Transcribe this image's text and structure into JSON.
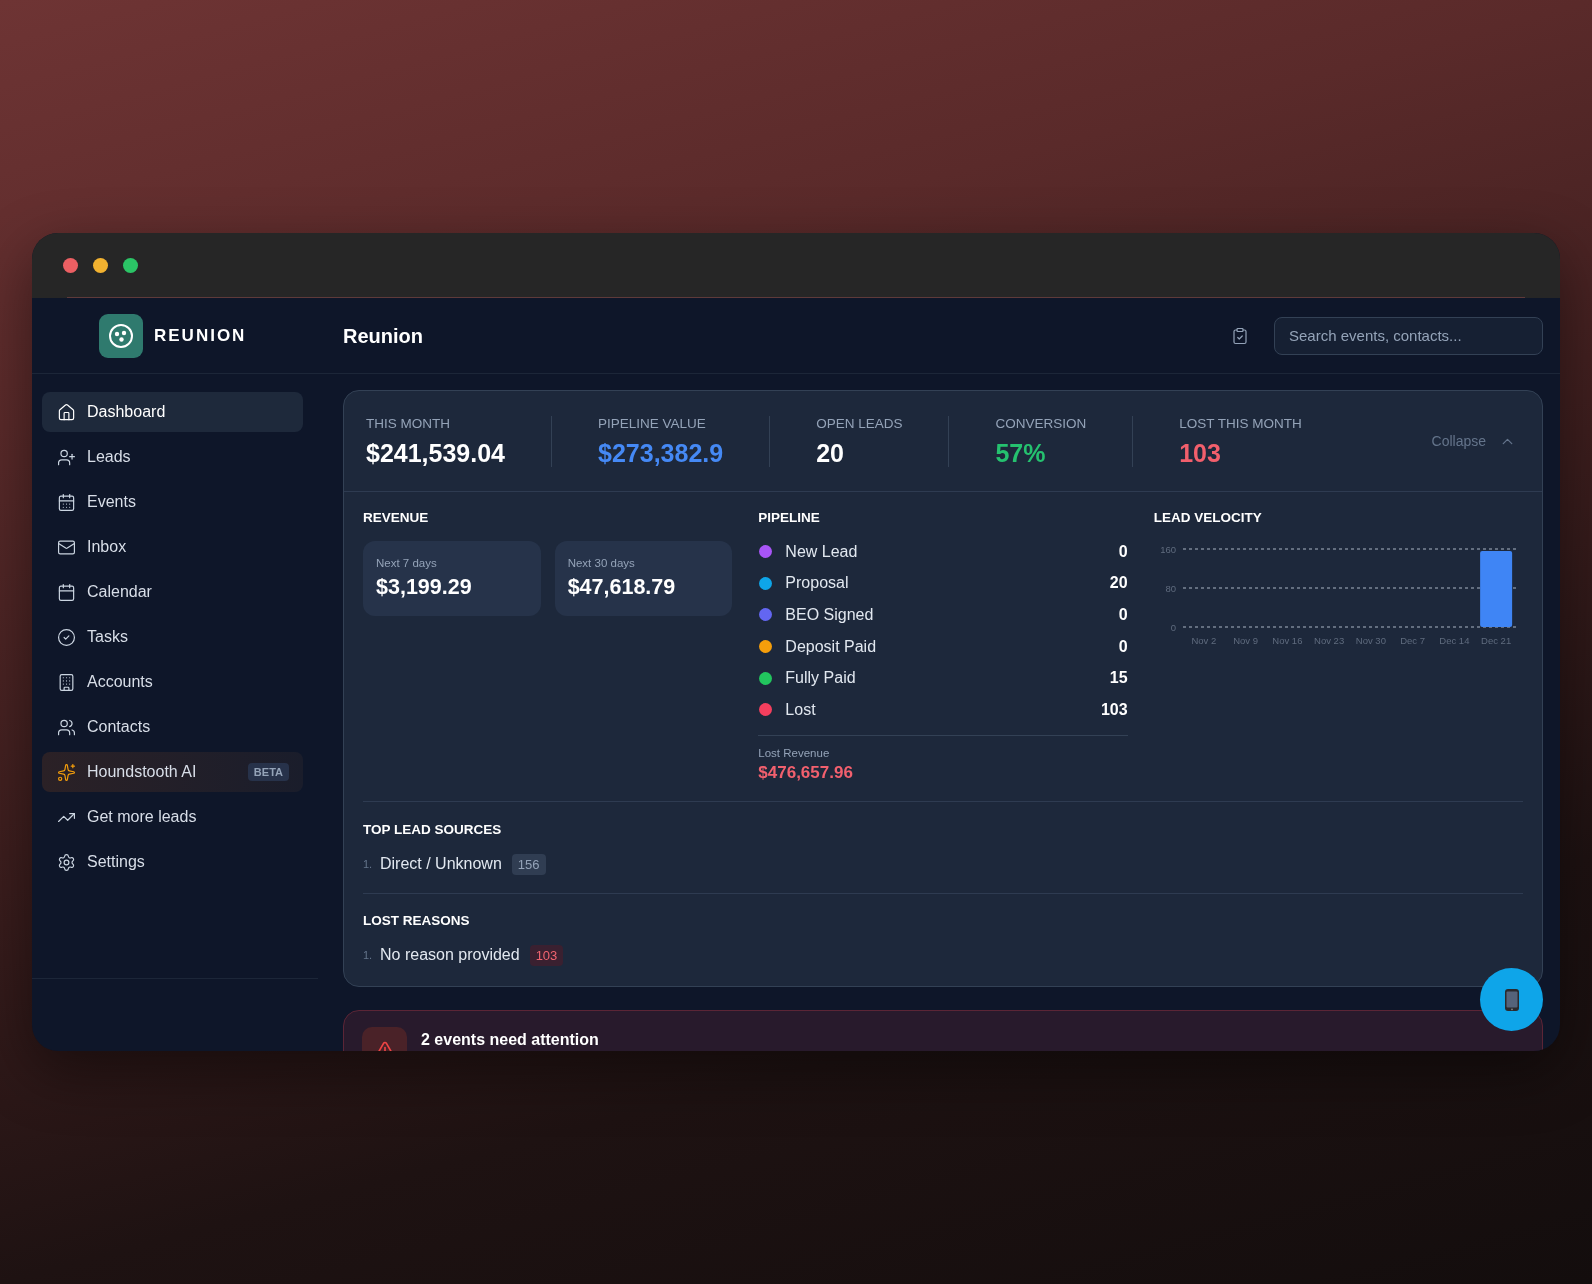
{
  "sidebar": {
    "brand": "REUNION",
    "items": [
      {
        "label": "Dashboard",
        "kind": "nav",
        "selected": true
      },
      {
        "label": "Leads",
        "kind": "nav",
        "selected": false
      },
      {
        "label": "Events",
        "kind": "nav",
        "selected": false
      },
      {
        "label": "Inbox",
        "kind": "nav",
        "selected": false
      },
      {
        "label": "Calendar",
        "kind": "nav",
        "selected": false
      },
      {
        "label": "Tasks",
        "kind": "nav",
        "selected": false
      },
      {
        "label": "Accounts",
        "kind": "nav",
        "selected": false
      },
      {
        "label": "Contacts",
        "kind": "nav",
        "selected": false
      },
      {
        "label": "Houndstooth AI",
        "kind": "feature",
        "selected": false,
        "badge": "BETA"
      },
      {
        "label": "Get more leads",
        "kind": "nav",
        "selected": false
      },
      {
        "label": "Settings",
        "kind": "nav",
        "selected": false
      }
    ]
  },
  "header": {
    "title": "Reunion",
    "search": {
      "placeholder": "Search events, contacts..."
    }
  },
  "summary": {
    "stats": [
      {
        "label": "THIS MONTH",
        "value": "$241,539.04",
        "color": "#ffffff"
      },
      {
        "label": "PIPELINE VALUE",
        "value": "$273,382.9",
        "color": "#4589f5"
      },
      {
        "label": "OPEN LEADS",
        "value": "20",
        "color": "#ffffff"
      },
      {
        "label": "CONVERSION",
        "value": "57%",
        "color": "#25c16f"
      },
      {
        "label": "LOST THIS MONTH",
        "value": "103",
        "color": "#f25f6c"
      }
    ],
    "collapse": {
      "label": "Collapse",
      "expanded": true
    }
  },
  "revenue": {
    "title": "REVENUE",
    "tiles": [
      {
        "label": "Next 7 days",
        "value": "$3,199.29"
      },
      {
        "label": "Next 30 days",
        "value": "$47,618.79"
      }
    ]
  },
  "pipeline": {
    "title": "PIPELINE",
    "stages": [
      {
        "label": "New Lead",
        "count": "0",
        "color": "#a855f7"
      },
      {
        "label": "Proposal",
        "count": "20",
        "color": "#0ea5e9"
      },
      {
        "label": "BEO Signed",
        "count": "0",
        "color": "#6366f1"
      },
      {
        "label": "Deposit Paid",
        "count": "0",
        "color": "#f59e0b"
      },
      {
        "label": "Fully Paid",
        "count": "15",
        "color": "#22c55e"
      },
      {
        "label": "Lost",
        "count": "103",
        "color": "#f43f5e"
      }
    ],
    "lost_revenue": {
      "label": "Lost Revenue",
      "value": "$476,657.96"
    }
  },
  "lead_velocity": {
    "chart_data": {
      "type": "bar",
      "title": "LEAD VELOCITY",
      "categories": [
        "Nov 2",
        "Nov 9",
        "Nov 16",
        "Nov 23",
        "Nov 30",
        "Dec 7",
        "Dec 14",
        "Dec 21"
      ],
      "values": [
        0,
        0,
        0,
        0,
        0,
        0,
        0,
        156
      ],
      "ylim": [
        0,
        160
      ],
      "yticks": [
        0,
        80,
        160
      ]
    }
  },
  "top_lead_sources": {
    "title": "TOP LEAD SOURCES",
    "items": [
      {
        "rank": "1.",
        "label": "Direct / Unknown",
        "count": "156"
      }
    ]
  },
  "lost_reasons": {
    "title": "LOST REASONS",
    "items": [
      {
        "rank": "1.",
        "label": "No reason provided",
        "count": "103"
      }
    ]
  },
  "alert": {
    "title": "2 events need attention"
  }
}
